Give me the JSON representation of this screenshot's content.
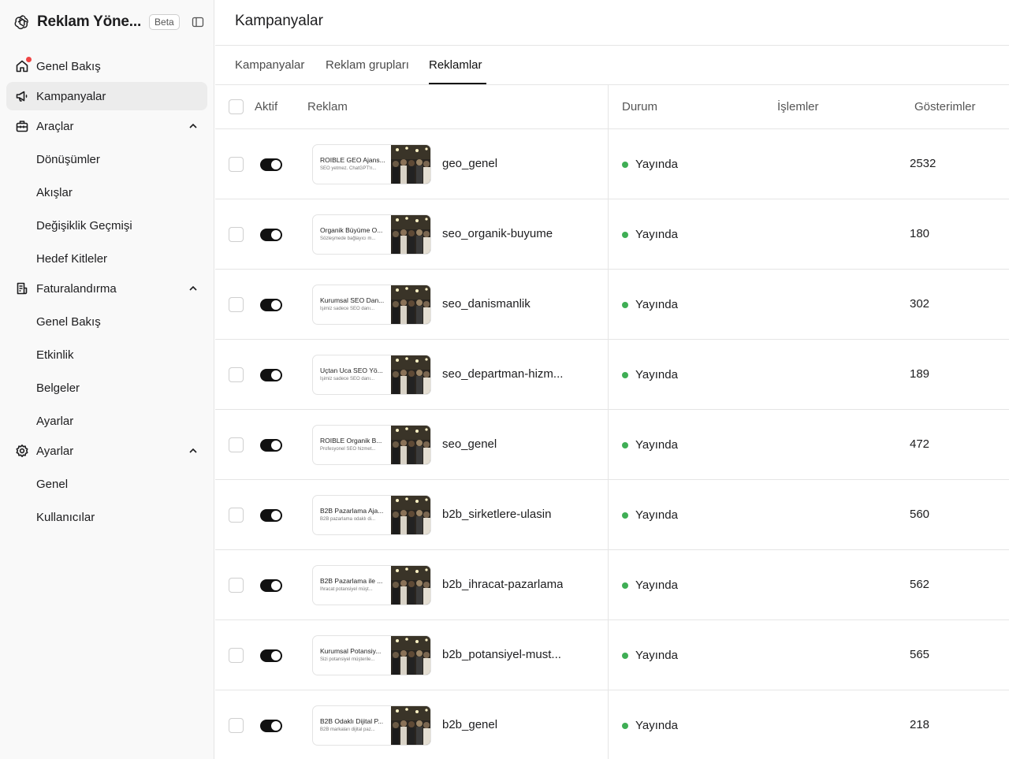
{
  "sidebar": {
    "app_title": "Reklam Yöne...",
    "beta_label": "Beta",
    "items": [
      {
        "label": "Genel Bakış"
      },
      {
        "label": "Kampanyalar"
      },
      {
        "label": "Araçlar"
      },
      {
        "label": "Dönüşümler"
      },
      {
        "label": "Akışlar"
      },
      {
        "label": "Değişiklik Geçmişi"
      },
      {
        "label": "Hedef Kitleler"
      },
      {
        "label": "Faturalandırma"
      },
      {
        "label": "Genel Bakış"
      },
      {
        "label": "Etkinlik"
      },
      {
        "label": "Belgeler"
      },
      {
        "label": "Ayarlar"
      },
      {
        "label": "Ayarlar"
      },
      {
        "label": "Genel"
      },
      {
        "label": "Kullanıcılar"
      }
    ]
  },
  "header": {
    "title": "Kampanyalar"
  },
  "tabs": [
    {
      "label": "Kampanyalar"
    },
    {
      "label": "Reklam grupları"
    },
    {
      "label": "Reklamlar"
    }
  ],
  "table": {
    "columns": {
      "active": "Aktif",
      "ad": "Reklam",
      "status": "Durum",
      "actions": "İşlemler",
      "impressions": "Gösterimler"
    },
    "rows": [
      {
        "card_title": "ROIBLE GEO Ajans...",
        "card_desc": "SEO yetmez. ChatGPT'n...",
        "name": "geo_genel",
        "status": "Yayında",
        "impressions": "2532"
      },
      {
        "card_title": "Organik Büyüme O...",
        "card_desc": "Sözleşmede bağlayıcı m...",
        "name": "seo_organik-buyume",
        "status": "Yayında",
        "impressions": "180"
      },
      {
        "card_title": "Kurumsal SEO Dan...",
        "card_desc": "İşimiz sadece SEO danı...",
        "name": "seo_danismanlik",
        "status": "Yayında",
        "impressions": "302"
      },
      {
        "card_title": "Uçtan Uca SEO Yö...",
        "card_desc": "İşimiz sadece SEO danı...",
        "name": "seo_departman-hizm...",
        "status": "Yayında",
        "impressions": "189"
      },
      {
        "card_title": "ROIBLE Organik B...",
        "card_desc": "Profesyonel SEO hizmet...",
        "name": "seo_genel",
        "status": "Yayında",
        "impressions": "472"
      },
      {
        "card_title": "B2B Pazarlama Aja...",
        "card_desc": "B2B pazarlama odaklı di...",
        "name": "b2b_sirketlere-ulasin",
        "status": "Yayında",
        "impressions": "560"
      },
      {
        "card_title": "B2B Pazarlama ile ...",
        "card_desc": "İhracat potansiyel müşt...",
        "name": "b2b_ihracat-pazarlama",
        "status": "Yayında",
        "impressions": "562"
      },
      {
        "card_title": "Kurumsal Potansiy...",
        "card_desc": "Sizi potansiyel müşterile...",
        "name": "b2b_potansiyel-must...",
        "status": "Yayında",
        "impressions": "565"
      },
      {
        "card_title": "B2B Odaklı Dijital P...",
        "card_desc": "B2B markaları dijital paz...",
        "name": "b2b_genel",
        "status": "Yayında",
        "impressions": "218"
      }
    ]
  },
  "colors": {
    "status_live": "#3fae55",
    "toggle_on": "#111111",
    "notification_dot": "#ef4444"
  }
}
